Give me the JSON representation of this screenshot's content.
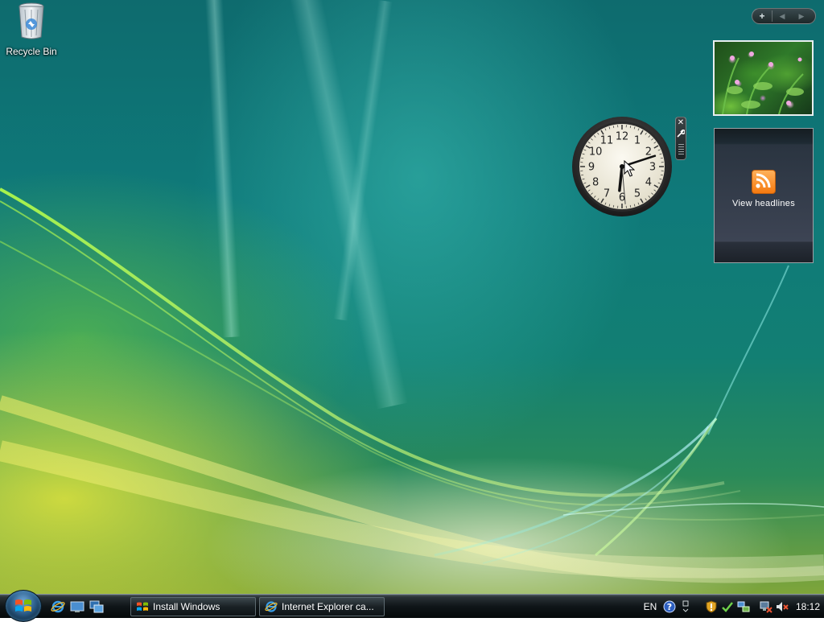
{
  "desktop": {
    "icons": [
      {
        "label": "Recycle Bin"
      }
    ]
  },
  "sidebar": {
    "add_gadget_symbol": "+",
    "prev_symbol": "◀",
    "next_symbol": "▶",
    "feed_gadget": {
      "label": "View headlines"
    },
    "clock_gadget": {
      "numerals": [
        "12",
        "1",
        "2",
        "3",
        "4",
        "5",
        "6",
        "7",
        "8",
        "9",
        "10",
        "11"
      ],
      "time": "18:12",
      "close_symbol": "✕"
    }
  },
  "taskbar": {
    "tasks": [
      {
        "label": "Install Windows"
      },
      {
        "label": "Internet Explorer ca..."
      }
    ],
    "tray": {
      "language": "EN",
      "help_symbol": "?",
      "clock": "18:12"
    }
  },
  "colors": {
    "rss_orange": "#f57a10",
    "taskbar_dark": "#0f1518",
    "desktop_teal": "#0f7a7a"
  }
}
